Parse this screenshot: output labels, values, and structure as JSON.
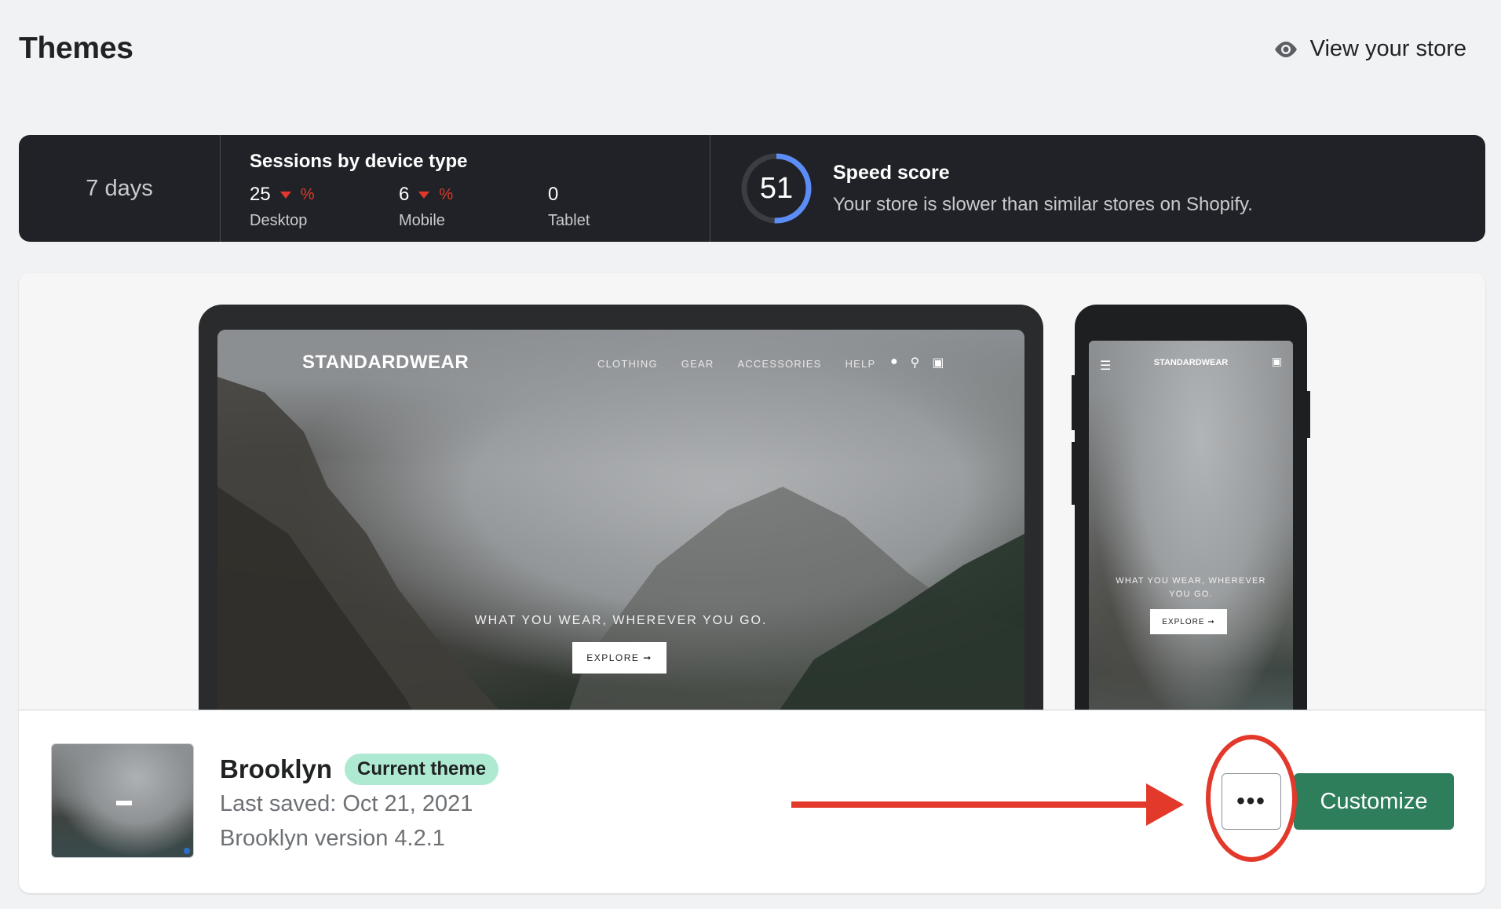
{
  "header": {
    "title": "Themes",
    "view_store_label": "View your store",
    "view_store_icon": "eye-icon"
  },
  "stats": {
    "range_label": "7 days",
    "sessions_title": "Sessions by device type",
    "devices": [
      {
        "value": "25",
        "trend": "down",
        "trend_unit": "%",
        "label": "Desktop"
      },
      {
        "value": "6",
        "trend": "down",
        "trend_unit": "%",
        "label": "Mobile"
      },
      {
        "value": "0",
        "label": "Tablet"
      }
    ],
    "speed": {
      "score": "51",
      "title": "Speed score",
      "description": "Your store is slower than similar stores on Shopify.",
      "ring_color": "#5c8df6"
    }
  },
  "preview": {
    "store_name": "STANDARDWEAR",
    "nav": [
      "CLOTHING",
      "GEAR",
      "ACCESSORIES",
      "HELP"
    ],
    "icons": [
      "user-icon",
      "search-icon",
      "cart-icon"
    ],
    "hero_text": "WHAT YOU WEAR, WHEREVER YOU GO.",
    "cta_label": "EXPLORE ➞",
    "mobile_hero_text": "WHAT YOU WEAR, WHEREVER YOU GO.",
    "mobile_cta_label": "EXPLORE ➞"
  },
  "theme": {
    "name": "Brooklyn",
    "badge": "Current theme",
    "last_saved": "Last saved: Oct 21, 2021",
    "version": "Brooklyn version 4.2.1",
    "more_label": "•••",
    "customize_label": "Customize"
  },
  "colors": {
    "primary_button": "#2e7d5b",
    "badge_bg": "#aee9d1",
    "annotation": "#e2392a",
    "trend_down": "#e0392b"
  }
}
